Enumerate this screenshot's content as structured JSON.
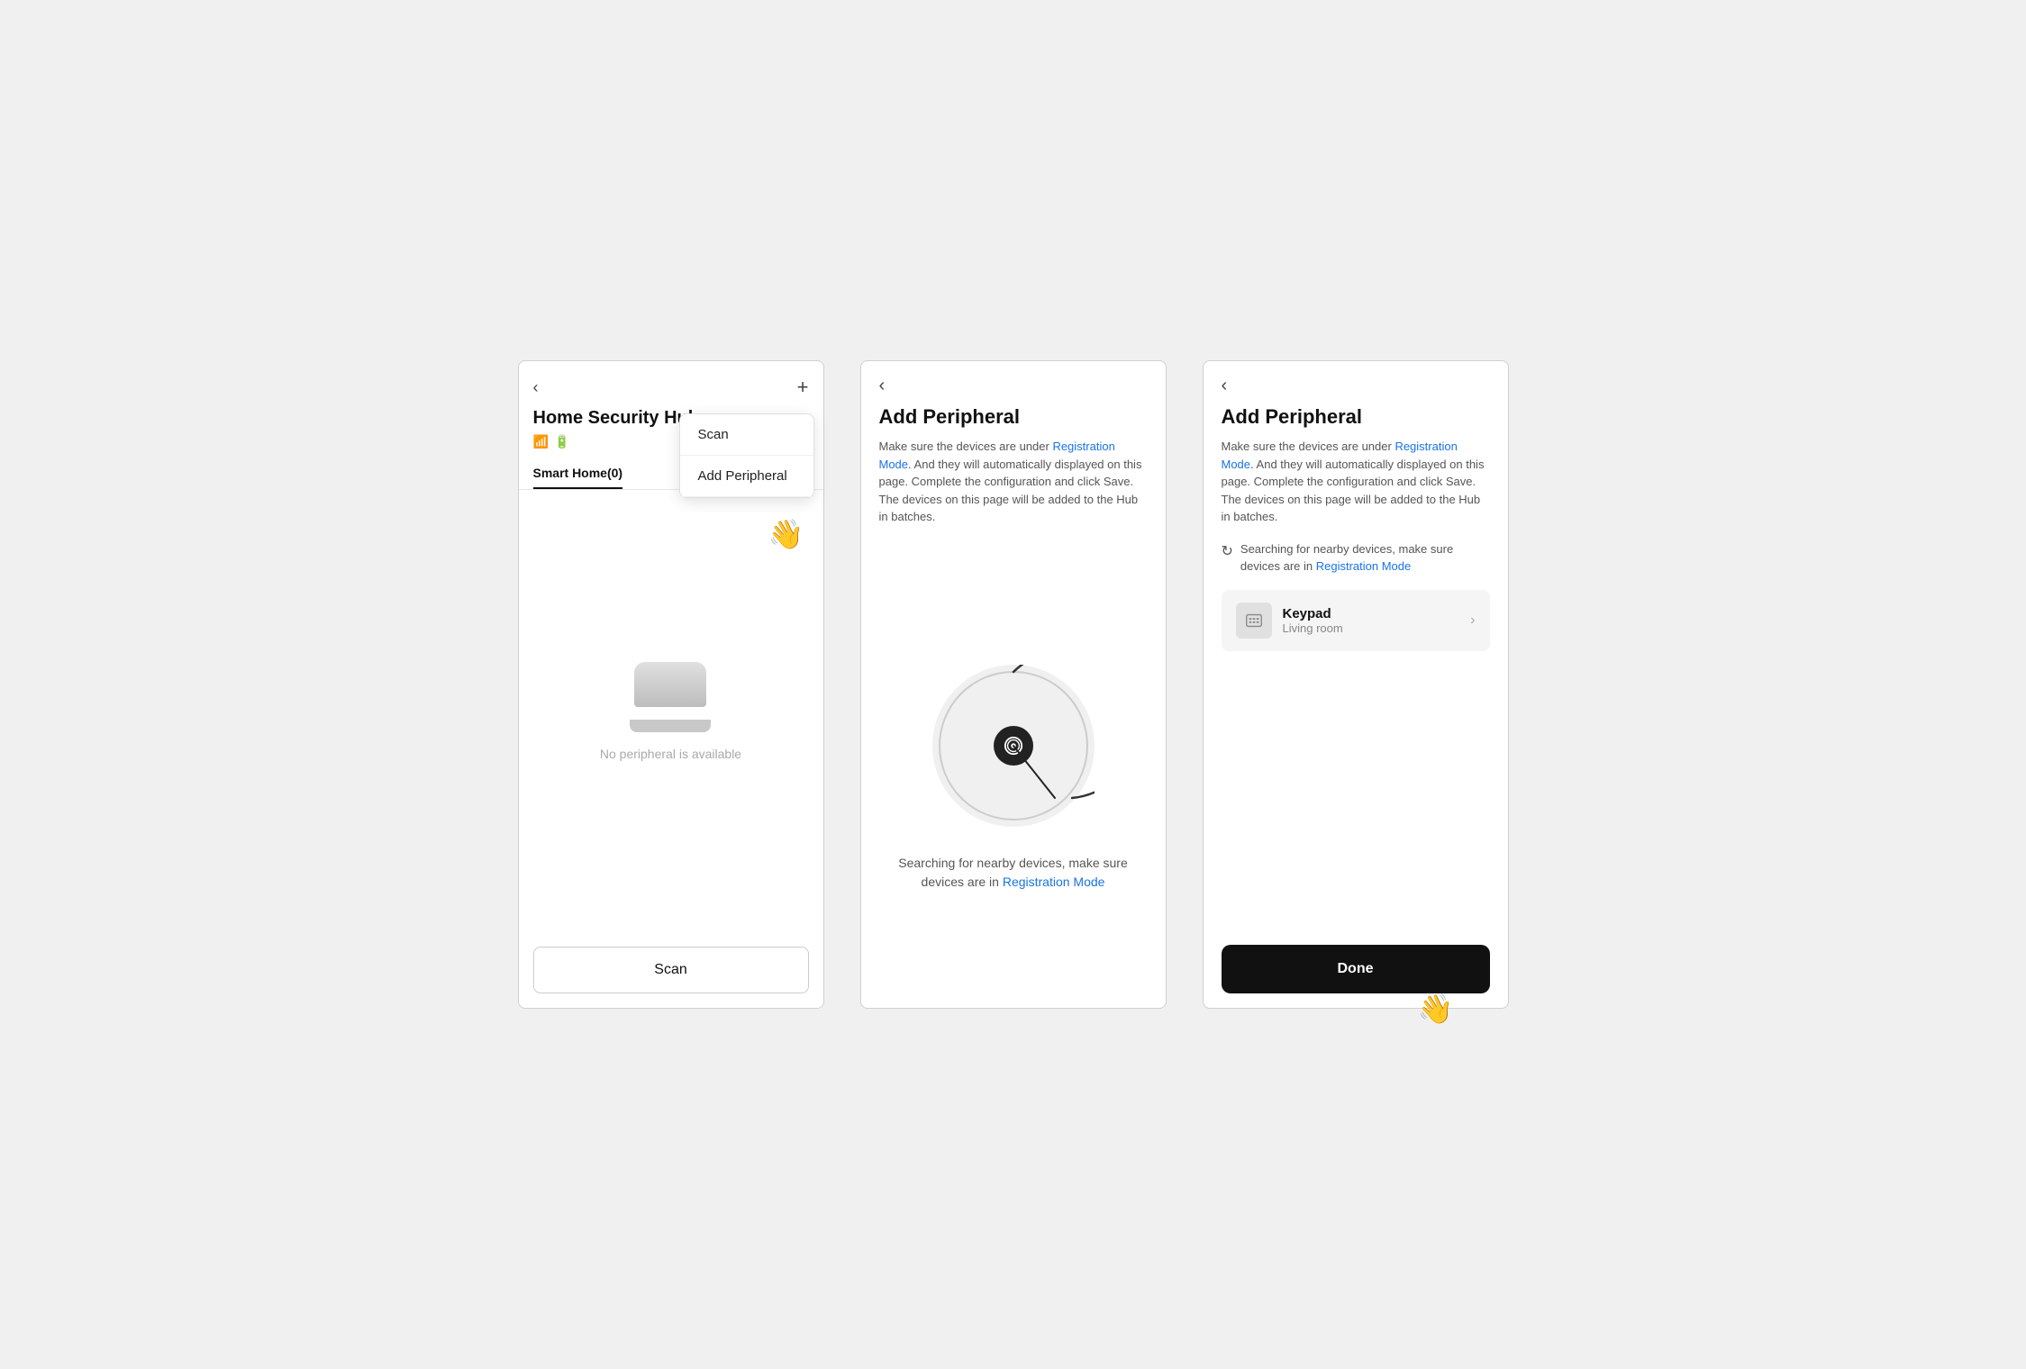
{
  "screen1": {
    "back_label": "‹",
    "plus_label": "+",
    "title": "Home Security Hub",
    "chevron": "›",
    "status_wifi": "wifi",
    "status_battery": "battery",
    "tab_smart_home": "Smart Home(0)",
    "no_device_text": "No peripheral is available",
    "scan_button": "Scan",
    "dropdown": {
      "items": [
        "Scan",
        "Add Peripheral"
      ]
    }
  },
  "screen2": {
    "back_label": "‹",
    "title": "Add Peripheral",
    "desc_part1": "Make sure the devices are under ",
    "desc_link": "Registration Mode",
    "desc_part2": ". And they will automatically displayed on this page. Complete the configuration and click Save. The devices on this page will be added to the Hub in batches.",
    "search_text_part1": "Searching for nearby devices, make sure devices are in ",
    "search_text_link": "Registration Mode"
  },
  "screen3": {
    "back_label": "‹",
    "title": "Add Peripheral",
    "desc_part1": "Make sure the devices are under ",
    "desc_link": "Registration Mode",
    "desc_part2": ". And they will automatically displayed on this page. Complete the configuration and click Save. The devices on this page will be added to the Hub in batches.",
    "searching_inline_part1": "Searching for nearby devices, make sure devices are in ",
    "searching_inline_link": "Registration Mode",
    "device": {
      "name": "Keypad",
      "room": "Living room"
    },
    "done_button": "Done"
  }
}
